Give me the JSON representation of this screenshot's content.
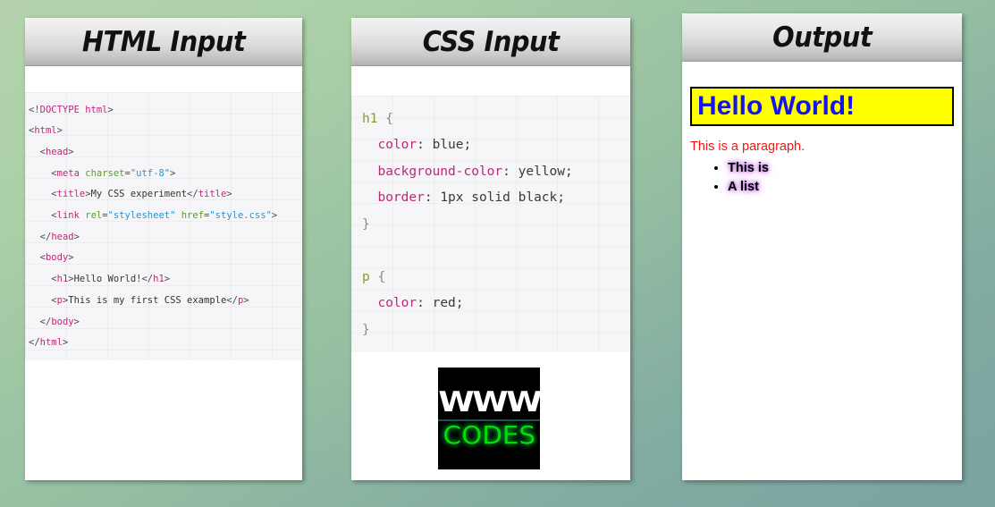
{
  "background": {
    "gradient_from": "#b4d3ac",
    "gradient_to": "#7ba39f"
  },
  "panels": [
    {
      "id": "html-input",
      "title": "HTML Input",
      "code_language": "html",
      "code_lines": [
        "<!DOCTYPE html>",
        "<html>",
        "  <head>",
        "    <meta charset=\"utf-8\">",
        "    <title>My CSS experiment</title>",
        "    <link rel=\"stylesheet\" href=\"style.css\">",
        "  </head>",
        "  <body>",
        "    <h1>Hello World!</h1>",
        "    <p>This is my first CSS example</p>",
        "  </body>",
        "</html>"
      ]
    },
    {
      "id": "css-input",
      "title": "CSS Input",
      "code_language": "css",
      "code_lines": [
        "h1 {",
        "  color: blue;",
        "  background-color: yellow;",
        "  border: 1px solid black;",
        "}",
        "",
        "p {",
        "  color: red;",
        "}"
      ]
    },
    {
      "id": "output",
      "title": "Output"
    }
  ],
  "output": {
    "heading": "Hello World!",
    "heading_color": "#1414f0",
    "heading_background": "#ffff00",
    "heading_border": "#000000",
    "paragraph": "This is a paragraph.",
    "paragraph_color": "#ff1010",
    "list_items": [
      "This is",
      "A list"
    ],
    "list_glow_color": "#c070e0"
  },
  "logo": {
    "top_text": "WWW",
    "bottom_text": "CODES",
    "top_color": "#ffffff",
    "bottom_color": "#00e000",
    "background": "#000000"
  },
  "syntax_colors": {
    "tag": "#c0267a",
    "attribute": "#5a9a2e",
    "value": "#2d8fc9",
    "punctuation": "#4a4a55",
    "selector": "#7ea12b",
    "property": "#c0267a",
    "declaration_value": "#3a3a3a"
  }
}
